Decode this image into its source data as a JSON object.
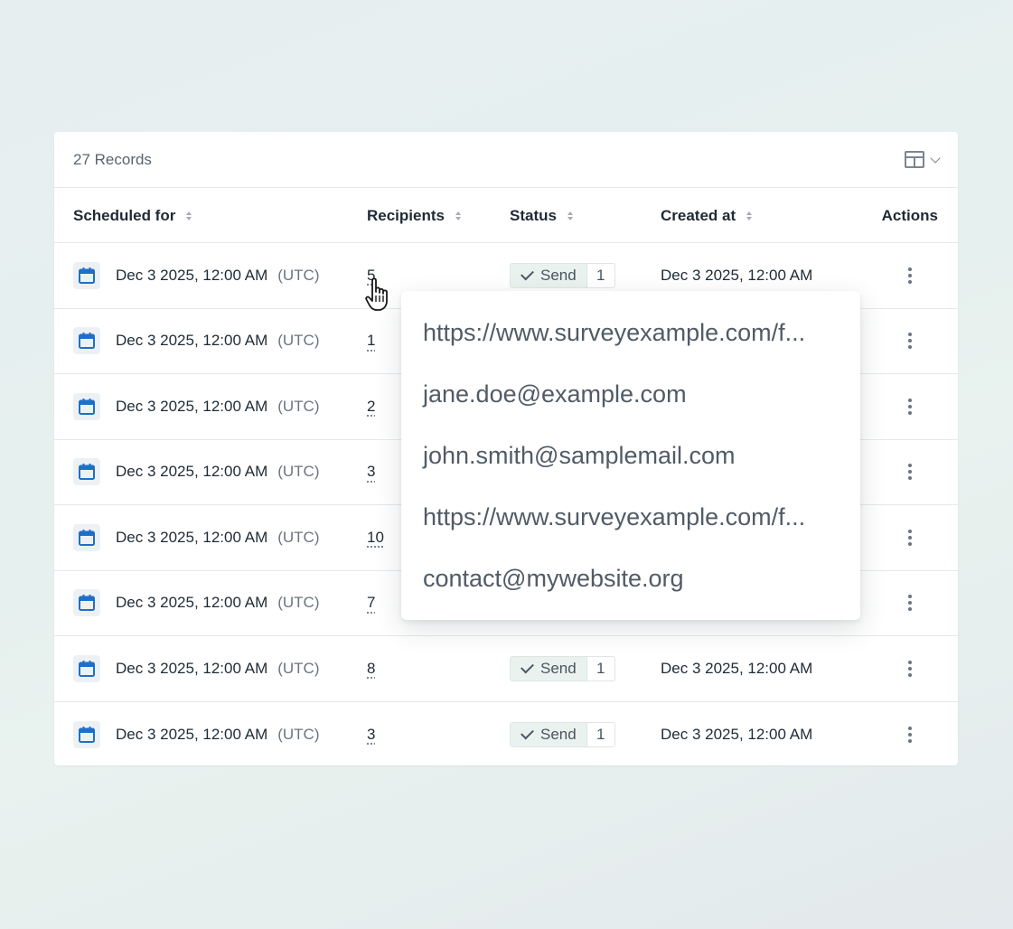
{
  "header": {
    "records_count": "27 Records"
  },
  "columns": {
    "scheduled_for": "Scheduled for",
    "recipients": "Recipients",
    "status": "Status",
    "created_at": "Created at",
    "actions": "Actions"
  },
  "rows": [
    {
      "scheduled": "Dec 3 2025, 12:00 AM",
      "tz": "(UTC)",
      "recipients": "5",
      "status": "Send",
      "status_count": "1",
      "created": "Dec 3 2025, 12:00 AM"
    },
    {
      "scheduled": "Dec 3 2025, 12:00 AM",
      "tz": "(UTC)",
      "recipients": "1",
      "status": "",
      "status_count": "",
      "created": ""
    },
    {
      "scheduled": "Dec 3 2025, 12:00 AM",
      "tz": "(UTC)",
      "recipients": "2",
      "status": "",
      "status_count": "",
      "created": ""
    },
    {
      "scheduled": "Dec 3 2025, 12:00 AM",
      "tz": "(UTC)",
      "recipients": "3",
      "status": "",
      "status_count": "",
      "created": ""
    },
    {
      "scheduled": "Dec 3 2025, 12:00 AM",
      "tz": "(UTC)",
      "recipients": "10",
      "status": "",
      "status_count": "",
      "created": ""
    },
    {
      "scheduled": "Dec 3 2025, 12:00 AM",
      "tz": "(UTC)",
      "recipients": "7",
      "status": "",
      "status_count": "",
      "created": ""
    },
    {
      "scheduled": "Dec 3 2025, 12:00 AM",
      "tz": "(UTC)",
      "recipients": "8",
      "status": "Send",
      "status_count": "1",
      "created": "Dec 3 2025, 12:00 AM"
    },
    {
      "scheduled": "Dec 3 2025, 12:00 AM",
      "tz": "(UTC)",
      "recipients": "3",
      "status": "Send",
      "status_count": "1",
      "created": "Dec 3 2025, 12:00 AM"
    }
  ],
  "popover": {
    "items": [
      "https://www.surveyexample.com/f...",
      "jane.doe@example.com",
      "john.smith@samplemail.com",
      "https://www.surveyexample.com/f...",
      "contact@mywebsite.org"
    ]
  },
  "icons": {
    "calendar": "calendar-icon",
    "layout": "table-layout-icon",
    "check": "check-icon",
    "actions": "more-vertical-icon",
    "cursor": "hand-pointer-cursor"
  },
  "colors": {
    "calendar_blue": "#1f6fc8",
    "status_bg": "#e9f2ee"
  }
}
